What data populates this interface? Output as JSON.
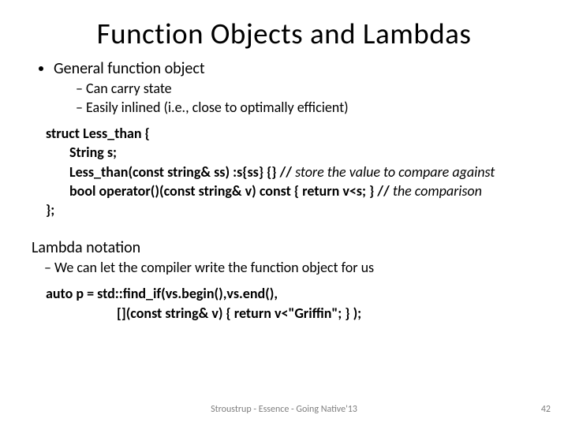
{
  "title": "Function Objects and Lambdas",
  "b1": {
    "heading": "General function object",
    "sub1": "Can carry state",
    "sub2": "Easily inlined (i.e., close to optimally efficient)"
  },
  "code1": {
    "l1": "struct Less_than {",
    "l2": "String s;",
    "l3a": "Less_than(const string& ss) :s{ss} {} // ",
    "l3c": "store the value to compare against",
    "l4a": "bool operator()(const string& v) const { return v<s; } // ",
    "l4c": "the comparison",
    "l5": "};"
  },
  "b2": {
    "heading": "Lambda notation",
    "sub1": "We can let the compiler write the function object for us"
  },
  "code2": {
    "l1": "auto p = std::find_if(vs.begin(),vs.end(),",
    "l2": "[](const string& v) { return v<\"Griffin\"; } );"
  },
  "footer": "Stroustrup - Essence - Going Native'13",
  "page": "42"
}
